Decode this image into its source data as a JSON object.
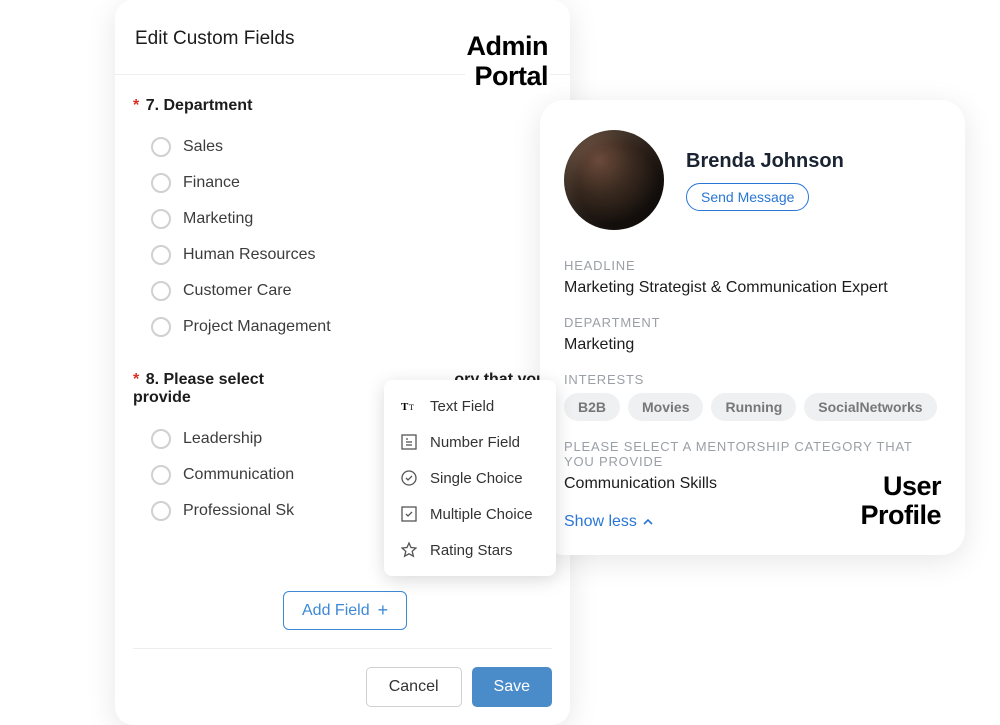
{
  "admin": {
    "title": "Edit Custom Fields",
    "banner_l1": "Admin",
    "banner_l2": "Portal",
    "field7": {
      "number": "7.",
      "label": "Department",
      "options": [
        "Sales",
        "Finance",
        "Marketing",
        "Human Resources",
        "Customer Care",
        "Project Management"
      ]
    },
    "field8": {
      "number": "8.",
      "label_before": "Please select",
      "label_after": "ory that you provide",
      "options": [
        "Leadership",
        "Communication",
        "Professional Sk"
      ]
    },
    "dropdown": [
      {
        "icon": "text",
        "label": "Text Field"
      },
      {
        "icon": "number",
        "label": "Number Field"
      },
      {
        "icon": "single",
        "label": "Single Choice"
      },
      {
        "icon": "multiple",
        "label": "Multiple Choice"
      },
      {
        "icon": "star",
        "label": "Rating Stars"
      }
    ],
    "add_field": "Add Field",
    "cancel": "Cancel",
    "save": "Save"
  },
  "profile": {
    "name": "Brenda Johnson",
    "send_message": "Send Message",
    "headline_label": "HEADLINE",
    "headline_value": "Marketing Strategist & Communication Expert",
    "department_label": "DEPARTMENT",
    "department_value": "Marketing",
    "interests_label": "INTERESTS",
    "interests": [
      "B2B",
      "Movies",
      "Running",
      "SocialNetworks"
    ],
    "mentorship_label": "PLEASE SELECT A MENTORSHIP CATEGORY THAT YOU PROVIDE",
    "mentorship_value": "Communication Skills",
    "show_less": "Show less",
    "banner_l1": "User",
    "banner_l2": "Profile"
  }
}
